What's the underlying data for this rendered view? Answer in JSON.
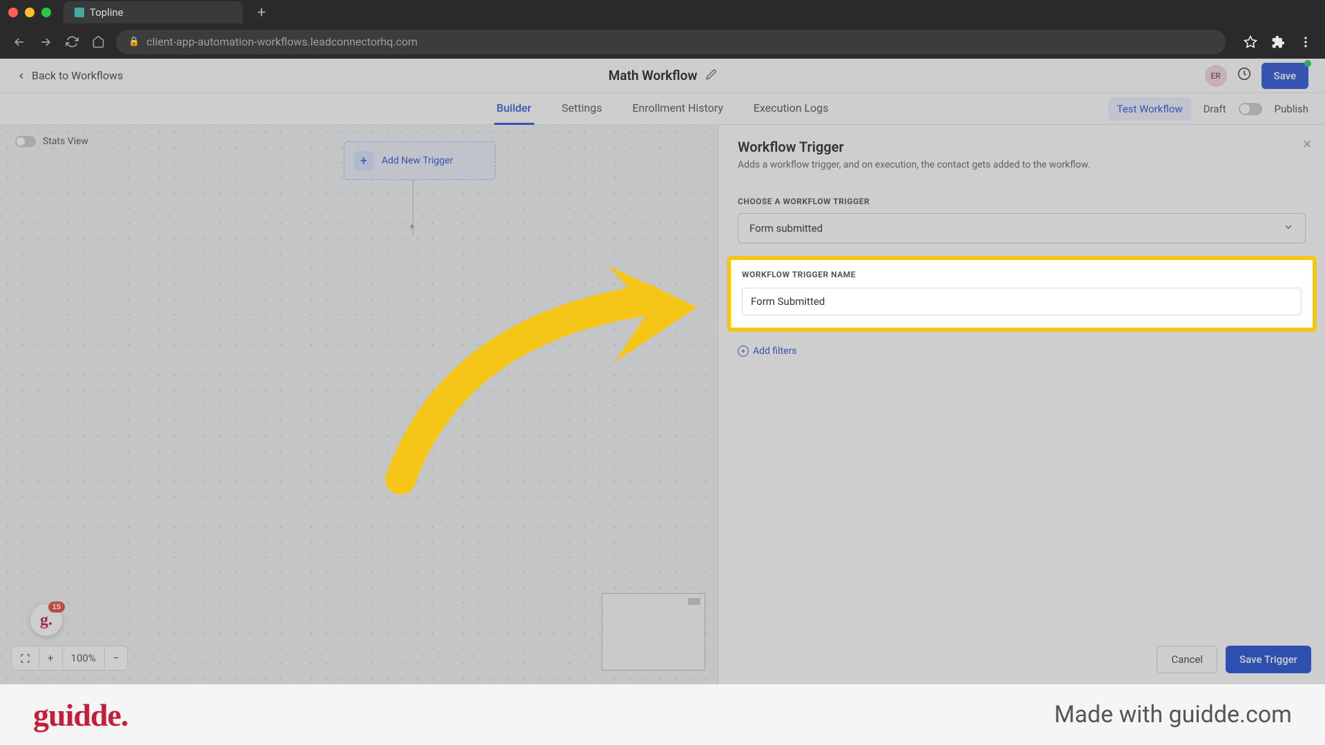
{
  "browser": {
    "tab_title": "Topline",
    "url": "client-app-automation-workflows.leadconnectorhq.com"
  },
  "header": {
    "back_label": "Back to Workflows",
    "title": "Math Workflow",
    "avatar": "ER",
    "save_label": "Save"
  },
  "tabs": {
    "items": [
      "Builder",
      "Settings",
      "Enrollment History",
      "Execution Logs"
    ],
    "active_index": 0,
    "test_label": "Test Workflow",
    "draft_label": "Draft",
    "publish_label": "Publish"
  },
  "canvas": {
    "stats_label": "Stats View",
    "add_trigger_label": "Add New Trigger",
    "zoom": "100%",
    "badge_count": "15"
  },
  "panel": {
    "title": "Workflow Trigger",
    "subtitle": "Adds a workflow trigger, and on execution, the contact gets added to the workflow.",
    "choose_label": "CHOOSE A WORKFLOW TRIGGER",
    "selected_trigger": "Form submitted",
    "name_label": "WORKFLOW TRIGGER NAME",
    "name_value": "Form Submitted",
    "add_filters_label": "Add filters",
    "cancel_label": "Cancel",
    "save_trigger_label": "Save Trigger"
  },
  "watermark": {
    "logo": "guidde.",
    "text": "Made with guidde.com"
  },
  "colors": {
    "highlight": "#f5c518",
    "primary": "#2e56d6",
    "brand": "#c41e3a"
  }
}
